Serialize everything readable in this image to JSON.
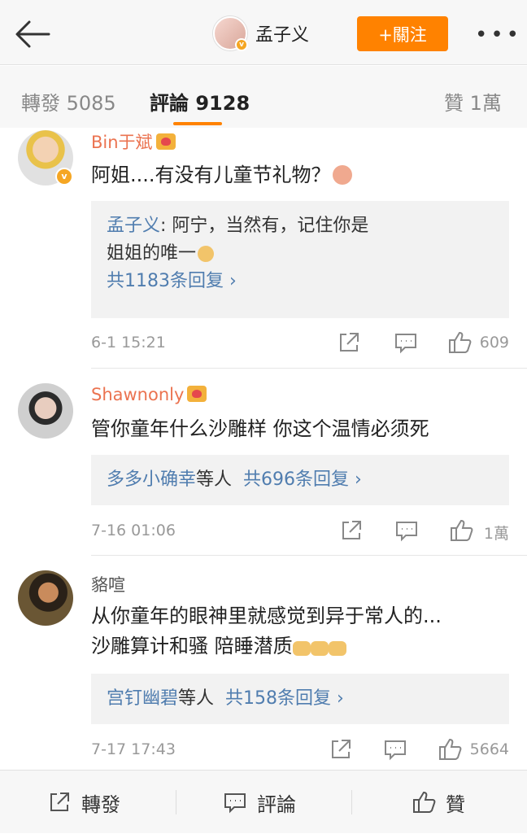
{
  "header": {
    "username": "孟子义",
    "follow_label": "+關注",
    "more": "•••",
    "verified": "v"
  },
  "tabs": {
    "repost": "轉發 5085",
    "comments": "評論 9128",
    "likes": "贊 1萬"
  },
  "comments": [
    {
      "name": "Bin于斌",
      "text": "阿姐....有没有儿童节礼物？",
      "reply_author": "孟子义",
      "reply_text_1": ": 阿宁，当然有，记住你是",
      "reply_text_2": "姐姐的唯一",
      "reply_more": "共1183条回复 ›",
      "time": "6-1 15:21",
      "likes": "609",
      "verified": "v"
    },
    {
      "name": "Shawnonly",
      "text": "管你童年什么沙雕样 你这个温情必须死",
      "reply_users": "多多小确幸",
      "reply_suffix": "等人",
      "reply_more": "共696条回复 ›",
      "time": "7-16 01:06",
      "likes": "1萬"
    },
    {
      "name": "貉喧",
      "text_1": "从你童年的眼神里就感觉到异于常人的...",
      "text_2": "沙雕算计和骚 陪睡潜质",
      "reply_users": "宫钉幽碧",
      "reply_suffix": "等人",
      "reply_more": "共158条回复 ›",
      "time": "7-17 17:43",
      "likes": "5664"
    }
  ],
  "bottom": {
    "repost": "轉發",
    "comment": "評論",
    "like": "贊"
  },
  "colors": {
    "accent": "#ff8200",
    "link": "#507daf",
    "name": "#eb7350"
  },
  "icons": [
    "back-arrow-icon",
    "share-icon",
    "comment-icon",
    "like-icon",
    "crown-icon",
    "emoji-icon"
  ]
}
